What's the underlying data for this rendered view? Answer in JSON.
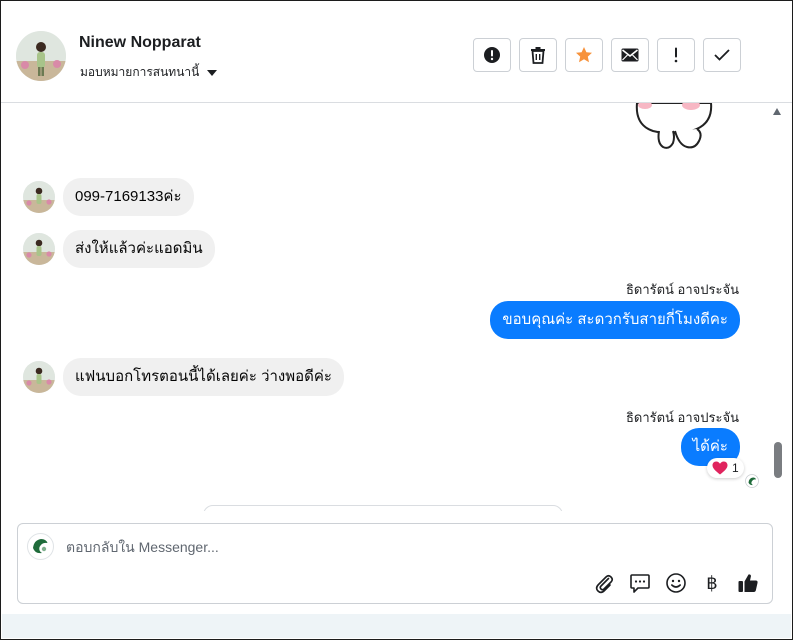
{
  "header": {
    "contact_name": "Ninew Nopparat",
    "assign_label": "มอบหมายการสนทนานี้"
  },
  "toolbar": {
    "buttons": [
      {
        "name": "mark-spam",
        "icon": "alert-circle-icon"
      },
      {
        "name": "delete",
        "icon": "trash-icon"
      },
      {
        "name": "star",
        "icon": "star-icon",
        "color": "#f7923b"
      },
      {
        "name": "mark-unread",
        "icon": "envelope-icon"
      },
      {
        "name": "follow-up",
        "icon": "exclamation-icon"
      },
      {
        "name": "mark-done",
        "icon": "check-icon"
      }
    ]
  },
  "messages": [
    {
      "direction": "in",
      "text": "099-7169133ค่ะ"
    },
    {
      "direction": "in",
      "text": "ส่งให้แล้วค่ะแอดมิน"
    },
    {
      "direction": "out",
      "sender": "ธิดารัตน์ อาจประจัน",
      "text": "ขอบคุณค่ะ สะดวกรับสายกี่โมงดีคะ"
    },
    {
      "direction": "in",
      "text": "แฟนบอกโทรตอนนี้ได้เลยค่ะ ว่างพอดีค่ะ"
    },
    {
      "direction": "out",
      "sender": "ธิดารัตน์ อาจประจัน",
      "text": "ได้ค่ะ",
      "reaction": {
        "emoji": "heart",
        "count": "1"
      }
    }
  ],
  "composer": {
    "placeholder": "ตอบกลับใน Messenger...",
    "tools": [
      "paperclip-icon",
      "chat-bubble-icon",
      "smiley-icon",
      "baht-icon",
      "thumbs-up-icon"
    ],
    "baht_symbol": "฿"
  },
  "colors": {
    "accent": "#0a7cff",
    "incoming_bubble": "#f0f0f0",
    "star": "#f7923b",
    "heart": "#e0245e"
  }
}
